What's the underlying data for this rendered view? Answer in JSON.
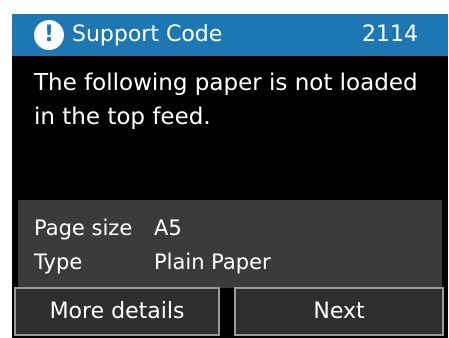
{
  "header": {
    "title": "Support Code",
    "code": "2114",
    "icon": "alert-icon",
    "color": "#1d77b2"
  },
  "message": "The following paper is not loaded in the top feed.",
  "info": {
    "rows": [
      {
        "key": "Page size",
        "value": "A5"
      },
      {
        "key": "Type",
        "value": "Plain Paper"
      }
    ]
  },
  "buttons": {
    "more_details": "More details",
    "next": "Next"
  }
}
